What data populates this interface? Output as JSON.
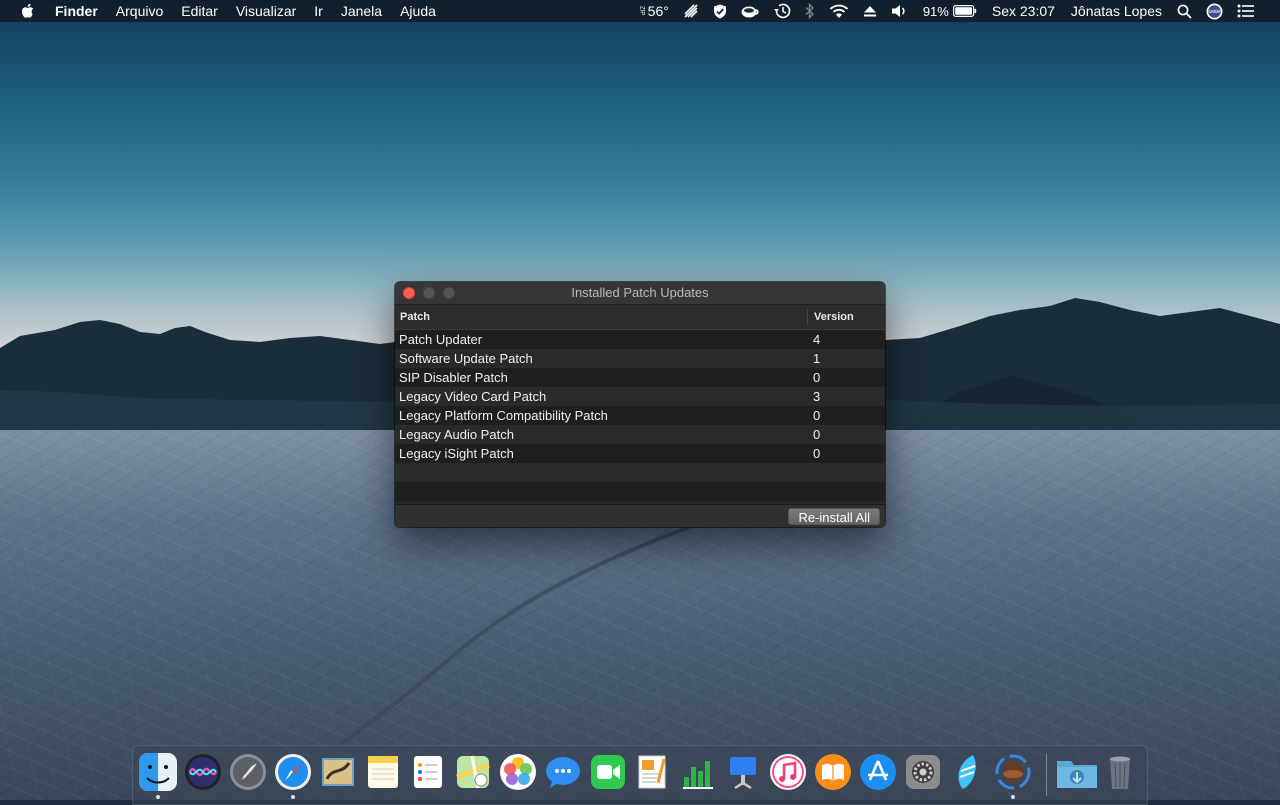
{
  "menubar": {
    "app_name": "Finder",
    "menus": [
      "Arquivo",
      "Editar",
      "Visualizar",
      "Ir",
      "Janela",
      "Ajuda"
    ],
    "status": {
      "weather_label": "ZIP",
      "temperature": "56°",
      "battery_percent": "91%",
      "clock": "Sex 23:07",
      "user_name": "Jônatas Lopes"
    }
  },
  "window": {
    "title": "Installed Patch Updates",
    "columns": {
      "patch": "Patch",
      "version": "Version"
    },
    "rows": [
      {
        "patch": "Patch Updater",
        "version": "4"
      },
      {
        "patch": "Software Update Patch",
        "version": "1"
      },
      {
        "patch": "SIP Disabler Patch",
        "version": "0"
      },
      {
        "patch": "Legacy Video Card Patch",
        "version": "3"
      },
      {
        "patch": "Legacy Platform Compatibility Patch",
        "version": "0"
      },
      {
        "patch": "Legacy Audio Patch",
        "version": "0"
      },
      {
        "patch": "Legacy iSight Patch",
        "version": "0"
      }
    ],
    "reinstall_button": "Re-install All"
  },
  "dock": {
    "apps": [
      {
        "name": "finder-icon",
        "running": true
      },
      {
        "name": "siri-icon",
        "running": false
      },
      {
        "name": "launchpad-icon",
        "running": false
      },
      {
        "name": "safari-icon",
        "running": true
      },
      {
        "name": "mail-icon",
        "running": false
      },
      {
        "name": "notes-icon",
        "running": false
      },
      {
        "name": "reminders-icon",
        "running": false
      },
      {
        "name": "maps-icon",
        "running": false
      },
      {
        "name": "photos-icon",
        "running": false
      },
      {
        "name": "messages-icon",
        "running": false
      },
      {
        "name": "facetime-icon",
        "running": false
      },
      {
        "name": "pages-icon",
        "running": false
      },
      {
        "name": "numbers-icon",
        "running": false
      },
      {
        "name": "keynote-icon",
        "running": false
      },
      {
        "name": "itunes-icon",
        "running": false
      },
      {
        "name": "books-icon",
        "running": false
      },
      {
        "name": "app-store-icon",
        "running": false
      },
      {
        "name": "system-preferences-icon",
        "running": false
      },
      {
        "name": "sublime-text-icon",
        "running": false
      },
      {
        "name": "patch-updater-icon",
        "running": true
      }
    ],
    "right": [
      {
        "name": "downloads-folder-icon"
      },
      {
        "name": "trash-icon"
      }
    ]
  }
}
